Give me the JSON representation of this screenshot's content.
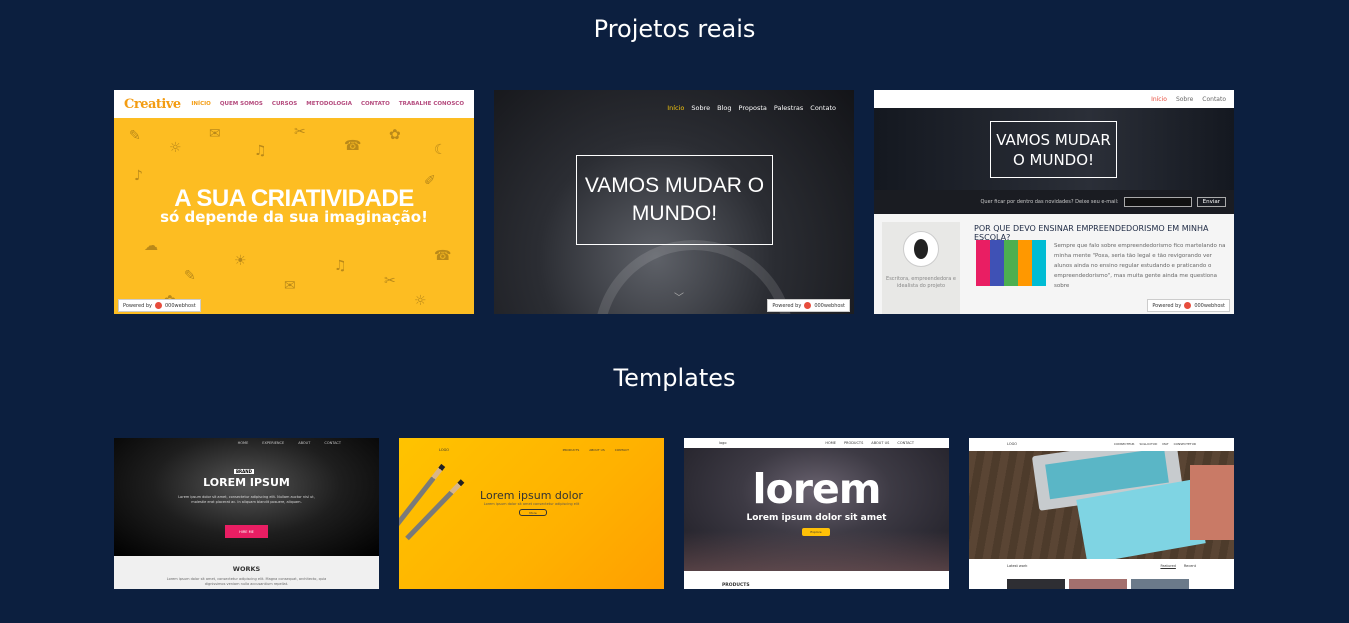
{
  "sections": {
    "real_title": "Projetos reais",
    "templates_title": "Templates"
  },
  "powered_by": {
    "label": "Powered by",
    "brand": "000webhost"
  },
  "project1": {
    "logo": "Creative",
    "menu": [
      "INÍCIO",
      "QUEM SOMOS",
      "CURSOS",
      "METODOLOGIA",
      "CONTATO",
      "TRABALHE CONOSCO"
    ],
    "headline": "A SUA CRIATIVIDADE",
    "subheadline": "só depende da sua imaginação!"
  },
  "project2": {
    "menu": [
      "Início",
      "Sobre",
      "Blog",
      "Proposta",
      "Palestras",
      "Contato"
    ],
    "headline": "VAMOS MUDAR O MUNDO!"
  },
  "project3": {
    "menu": [
      "Início",
      "Sobre",
      "Contato"
    ],
    "headline": "VAMOS MUDAR O MUNDO!",
    "signup_text": "Quer ficar por dentro das novidades? Deixe seu e-mail:",
    "signup_button": "Enviar",
    "article_title": "POR QUE DEVO ENSINAR EMPREENDEDORISMO EM MINHA ESCOLA?",
    "article_text": "Sempre que falo sobre empreendedorismo fico martelando na minha mente \"Poxa, seria tão legal e tão revigorando ver alunos ainda no ensino regular estudando e praticando o empreendedorismo\", mas muita gente ainda me questiona sobre",
    "profile_text": "Escritora, empreendedora e idealista do projeto"
  },
  "template1": {
    "nav": [
      "HOME",
      "EXPERIENCE",
      "ABOUT",
      "CONTACT"
    ],
    "badge": "BRAND",
    "headline": "LOREM IPSUM",
    "paragraph": "Lorem ipsum dolor sit amet, consectetur adipiscing elit. Nullam auctor nisl ut, molestie erat placerat ac. In aliquam blandit posuere, aliquam.",
    "cta": "HIRE ME",
    "section": "WORKS",
    "section_text": "Lorem ipsum dolor sit amet, consectetur adipiscing elit. Magna consequat, architecto, quia dignissimos veniam nulla accusantium repellat."
  },
  "template2": {
    "logo": "LOGO",
    "nav": [
      "PRODUCTS",
      "ABOUT US",
      "CONTACT"
    ],
    "headline": "Lorem ipsum dolor",
    "paragraph": "Lorem ipsum dolor sit amet consectetur adipiscing elit",
    "cta": "More"
  },
  "template3": {
    "logo": "logo",
    "nav": [
      "HOME",
      "PRODUCTS",
      "ABOUT US",
      "CONTACT"
    ],
    "headline": "lorem",
    "subheadline": "Lorem ipsum dolor sit amet",
    "cta": "Explore",
    "section": "PRODUCTS"
  },
  "template4": {
    "logo": "LOGO",
    "nav": [
      "CONSECTEUR",
      "SOLLICITUD",
      "MAT",
      "CONSECTETUR"
    ],
    "latest": "Latest work",
    "tabs": [
      "Featured",
      "Recent"
    ]
  }
}
